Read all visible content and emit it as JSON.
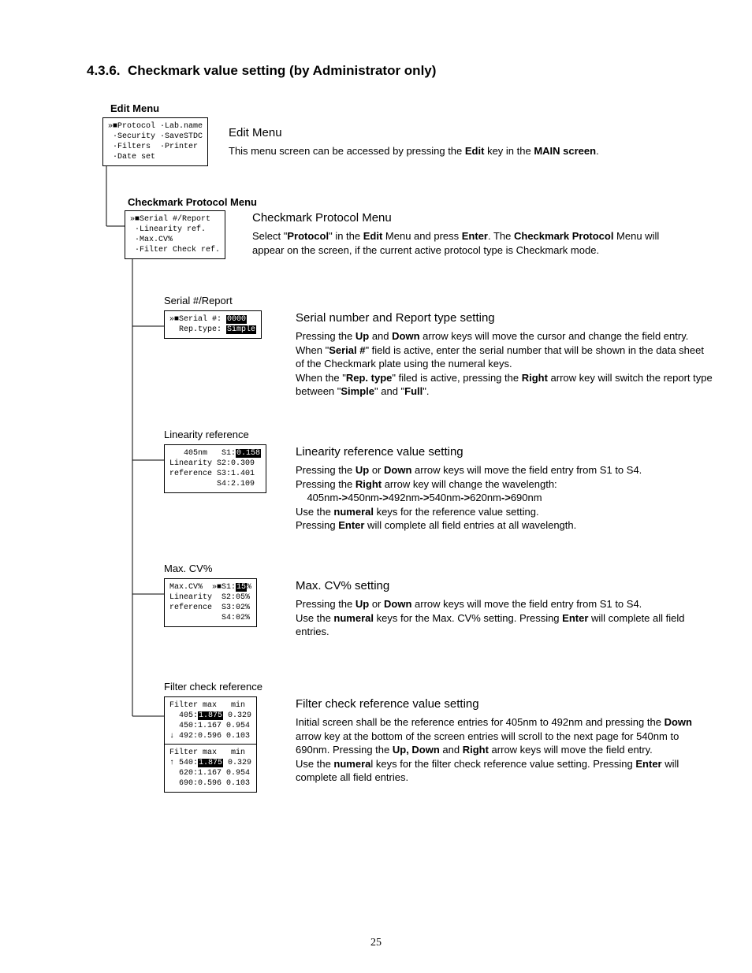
{
  "section_number": "4.3.6.",
  "section_title": "Checkmark value setting (by Administrator only)",
  "edit_menu": {
    "heading": "Edit Menu",
    "lcd_lines": [
      "»■Protocol ·Lab.name",
      " ·Security ·SaveSTDC",
      " ·Filters  ·Printer",
      " ·Date set"
    ],
    "desc_title": "Edit Menu",
    "desc_html": "This menu screen can be accessed by pressing the <b>Edit</b> key in the <b>MAIN screen</b>."
  },
  "cpm": {
    "heading": "Checkmark Protocol Menu",
    "lcd_lines": [
      "»■Serial #/Report",
      " ·Linearity ref.",
      " ·Max.CV%",
      " ·Filter Check ref."
    ],
    "desc_title": "Checkmark Protocol Menu",
    "desc_html": "Select \"<b>Protocol</b>\" in the <b>Edit</b> Menu and press <b>Enter</b>. The <b>Checkmark Protocol</b> Menu will appear on the screen, if the current active protocol type is Checkmark mode."
  },
  "serial": {
    "label": "Serial #/Report",
    "lcd_pre": "»■Serial #: ",
    "lcd_hl": "0000",
    "lcd_line2_pre": "  Rep.type: ",
    "lcd_line2_hl": "Simple",
    "desc_title": "Serial number and Report type setting",
    "desc_html": "Pressing the <b>Up</b> and <b>Down</b> arrow keys will move the cursor and change the field entry.<br>When \"<b>Serial #</b>\" field is active, enter the serial number that will be shown in the data sheet of the Checkmark plate using the numeral keys.<br>When the \"<b>Rep. type</b>\" filed is active, pressing the <b>Right</b> arrow key will switch the report type between \"<b>Simple</b>\" and \"<b>Full</b>\"."
  },
  "linearity": {
    "label": "Linearity reference",
    "lcd_lines": [
      {
        "pre": "   405nm   S1:",
        "hl": "0.158"
      },
      {
        "pre": "Linearity S2:0.309",
        "hl": ""
      },
      {
        "pre": "reference S3:1.401",
        "hl": ""
      },
      {
        "pre": "          S4:2.109",
        "hl": ""
      }
    ],
    "desc_title": "Linearity reference value setting",
    "desc_html": "Pressing the <b>Up</b> or <b>Down</b> arrow keys will move the field entry from S1 to S4.<br>Pressing the <b>Right</b> arrow key will change the wavelength:<br>&nbsp;&nbsp;&nbsp;&nbsp;405nm<b>-&gt;</b>450nm<b>-&gt;</b>492nm<b>-&gt;</b>540nm<b>-&gt;</b>620nm<b>-&gt;</b>690nm<br>Use the <b>numeral</b> keys for the reference value setting.<br>Pressing <b>Enter</b> will complete all field entries at all wavelength."
  },
  "maxcv": {
    "label": "Max. CV%",
    "lcd_lines": [
      {
        "pre": "Max.CV%  »■S1:",
        "hl": "15",
        "post": "%"
      },
      {
        "pre": "Linearity  S2:05%",
        "hl": "",
        "post": ""
      },
      {
        "pre": "reference  S3:02%",
        "hl": "",
        "post": ""
      },
      {
        "pre": "           S4:02%",
        "hl": "",
        "post": ""
      }
    ],
    "desc_title": "Max. CV% setting",
    "desc_html": "Pressing the <b>Up</b> or <b>Down</b> arrow keys will move the field entry from S1 to S4.<br>Use the <b>numeral</b> keys for the Max. CV% setting. Pressing <b>Enter</b> will complete all field entries."
  },
  "filtercheck": {
    "label": "Filter check reference",
    "lcd1_lines": [
      {
        "pre": "Filter max   min",
        "hl": ""
      },
      {
        "pre": "  405:",
        "hl": "1.875",
        "post": " 0.329"
      },
      {
        "pre": "  450:1.167 0.954",
        "hl": ""
      },
      {
        "pre": "↓ 492:0.596 0.103",
        "hl": ""
      }
    ],
    "lcd2_lines": [
      {
        "pre": "Filter max   min",
        "hl": ""
      },
      {
        "pre": "↑ 540:",
        "hl": "1.875",
        "post": " 0.329"
      },
      {
        "pre": "  620:1.167 0.954",
        "hl": ""
      },
      {
        "pre": "  690:0.596 0.103",
        "hl": ""
      }
    ],
    "desc_title": "Filter check reference value setting",
    "desc_html": "Initial screen shall be the reference entries for 405nm to 492nm and pressing the <b>Down</b> arrow key at the bottom of the screen entries will scroll to the next page for 540nm to 690nm. Pressing the <b>Up, Down</b> and <b>Right</b> arrow keys will move the field entry.<br>Use the <b>numera</b>l keys for the filter check reference value setting. Pressing <b>Enter</b> will complete all field entries."
  },
  "page_number": "25"
}
